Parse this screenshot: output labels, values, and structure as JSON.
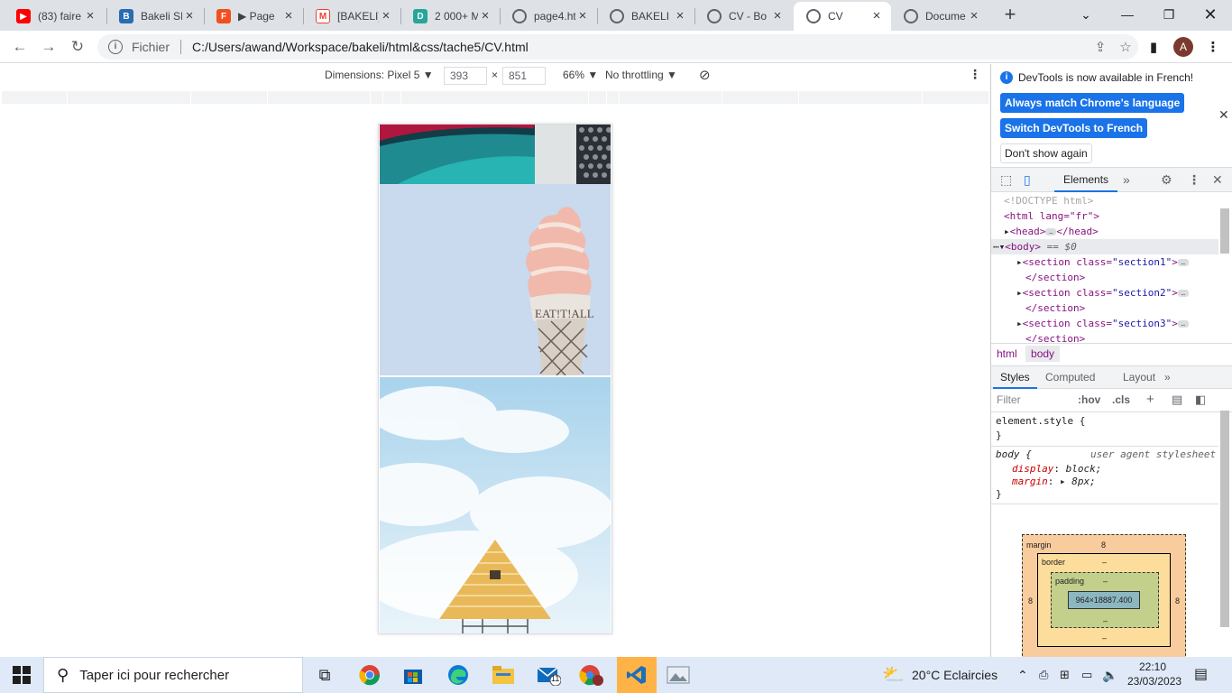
{
  "tabs": [
    {
      "title": "(83) faire",
      "favicon": "youtube-icon",
      "color": "#ff0000"
    },
    {
      "title": "Bakeli SI",
      "favicon": "bakeli-icon",
      "color": "#2b6cb0"
    },
    {
      "title": "▶ Page",
      "favicon": "figma-icon",
      "color": "#f24e1e"
    },
    {
      "title": "[BAKELI]",
      "favicon": "gmail-icon",
      "color": "#ea4335"
    },
    {
      "title": "2 000+ M",
      "favicon": "d-icon",
      "color": "#26a69a"
    },
    {
      "title": "page4.ht",
      "favicon": "globe-icon",
      "color": "#5f6368"
    },
    {
      "title": "BAKELI",
      "favicon": "globe-icon",
      "color": "#5f6368"
    },
    {
      "title": "CV - Bo",
      "favicon": "globe-icon",
      "color": "#5f6368"
    },
    {
      "title": "CV",
      "favicon": "globe-icon",
      "color": "#5f6368",
      "active": true
    },
    {
      "title": "Docume",
      "favicon": "globe-icon",
      "color": "#5f6368"
    }
  ],
  "toolbar": {
    "scheme": "Fichier",
    "url": "C:/Users/awand/Workspace/bakeli/html&css/tache5/CV.html",
    "avatar": "A"
  },
  "device_toolbar": {
    "dimensions_label": "Dimensions: Pixel 5 ▼",
    "width": "393",
    "times": "×",
    "height": "851",
    "zoom": "66% ▼",
    "throttling": "No throttling ▼"
  },
  "devtools": {
    "notice": "DevTools is now available in French!",
    "btn_match": "Always match Chrome's language",
    "btn_switch": "Switch DevTools to French",
    "btn_dont": "Don't show again",
    "tab_elements": "Elements",
    "dom": {
      "doctype": "<!DOCTYPE html>",
      "html_open": "<html lang=\"fr\">",
      "head": "<head>",
      "head_close": "</head>",
      "body": "<body>",
      "body_eq": "== $0",
      "section_open": "<section class=",
      "section_close": "</section>",
      "s1": "\"section1\"",
      "s2": "\"section2\"",
      "s3": "\"section3\"",
      "gt": ">"
    },
    "breadcrumbs": [
      "html",
      "body"
    ],
    "style_tabs": [
      "Styles",
      "Computed",
      "Layout"
    ],
    "filter_placeholder": "Filter",
    "hov": ":hov",
    "cls": ".cls",
    "rules": {
      "element_style": "element.style {",
      "close": "}",
      "body_selector": "body {",
      "ua": "user agent stylesheet",
      "display_prop": "display",
      "display_val": "block;",
      "margin_prop": "margin",
      "margin_val": "8px;"
    },
    "box_model": {
      "margin_label": "margin",
      "margin_top": "8",
      "margin_left": "8",
      "margin_right": "8",
      "border_label": "border",
      "border_val": "–",
      "padding_label": "padding",
      "padding_val": "–",
      "content": "964×18887.400",
      "dash": "–"
    }
  },
  "taskbar": {
    "search_placeholder": "Taper ici pour rechercher",
    "weather": "20°C  Eclaircies",
    "time": "22:10",
    "date": "23/03/2023",
    "mail_badge": "11"
  }
}
